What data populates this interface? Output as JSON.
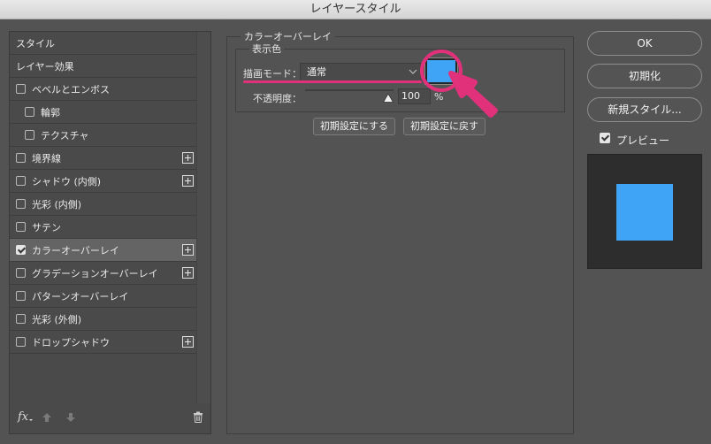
{
  "window": {
    "title": "レイヤースタイル"
  },
  "sidebar": {
    "items": [
      {
        "label": "スタイル",
        "type": "header"
      },
      {
        "label": "レイヤー効果",
        "type": "header"
      },
      {
        "label": "ベベルとエンボス",
        "checked": false,
        "plus": false
      },
      {
        "label": "輪郭",
        "checked": false,
        "plus": false,
        "sub": true
      },
      {
        "label": "テクスチャ",
        "checked": false,
        "plus": false,
        "sub": true
      },
      {
        "label": "境界線",
        "checked": false,
        "plus": true
      },
      {
        "label": "シャドウ (内側)",
        "checked": false,
        "plus": true
      },
      {
        "label": "光彩 (内側)",
        "checked": false,
        "plus": false
      },
      {
        "label": "サテン",
        "checked": false,
        "plus": false
      },
      {
        "label": "カラーオーバーレイ",
        "checked": true,
        "plus": true,
        "selected": true
      },
      {
        "label": "グラデーションオーバーレイ",
        "checked": false,
        "plus": true
      },
      {
        "label": "パターンオーバーレイ",
        "checked": false,
        "plus": false
      },
      {
        "label": "光彩 (外側)",
        "checked": false,
        "plus": false
      },
      {
        "label": "ドロップシャドウ",
        "checked": false,
        "plus": true
      }
    ],
    "fx_label": "fx"
  },
  "main": {
    "group_title": "カラーオーバーレイ",
    "subgroup_title": "表示色",
    "blend_mode_label": "描画モード：",
    "blend_mode_value": "通常",
    "opacity_label": "不透明度：",
    "opacity_value": "100",
    "opacity_unit": "%",
    "opacity_level": 1.0,
    "overlay_color": "#3fa3f6",
    "set_default_button": "初期設定にする",
    "reset_default_button": "初期設定に戻す"
  },
  "actions": {
    "ok": "OK",
    "reset": "初期化",
    "new_style": "新規スタイル...",
    "preview_label": "プレビュー",
    "preview_checked": true
  },
  "colors": {
    "annotation": "#e0317a",
    "swatch": "#3fa3f6"
  }
}
